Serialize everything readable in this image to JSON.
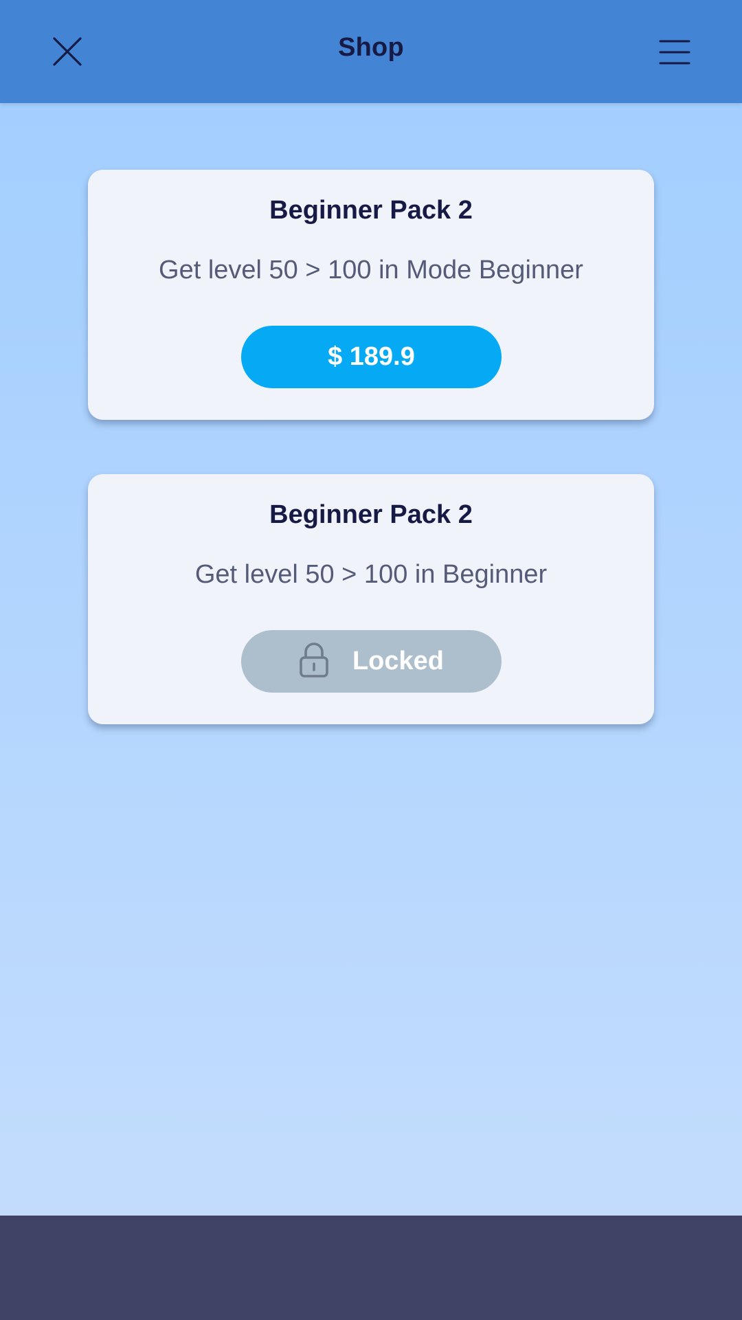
{
  "header": {
    "title": "Shop"
  },
  "packs": [
    {
      "title": "Beginner Pack 2",
      "description": "Get level 50 > 100 in Mode Beginner",
      "button_label": "$ 189.9"
    },
    {
      "title": "Beginner Pack 2",
      "description": "Get level 50 > 100 in Beginner",
      "button_label": "Locked"
    }
  ],
  "icons": {
    "close": "close-icon",
    "menu": "hamburger-menu-icon",
    "lock": "lock-icon"
  },
  "colors": {
    "header_bg": "#4384d4",
    "background_top": "#a0cdfe",
    "background_bottom": "#c6defd",
    "card_bg": "#f0f3f9",
    "buy_button": "#06aaf4",
    "locked_button": "#adbfcc",
    "footer_bg": "#3f4466",
    "title_text": "#161a45",
    "desc_text": "#555a78"
  }
}
